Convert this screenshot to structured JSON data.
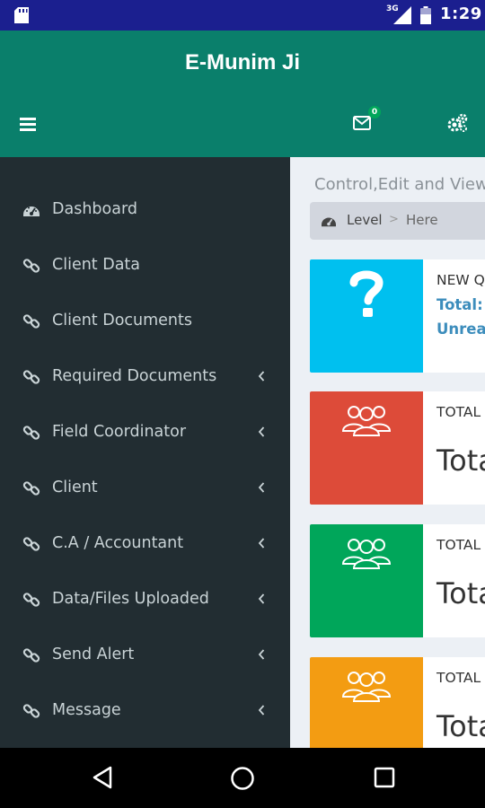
{
  "status_bar": {
    "network": "3G",
    "time": "1:29"
  },
  "app": {
    "title": "E-Munim Ji",
    "mail_badge": "0"
  },
  "sidebar": {
    "items": [
      {
        "label": "Dashboard",
        "icon": "dashboard-icon",
        "has_submenu": false
      },
      {
        "label": "Client Data",
        "icon": "link-icon",
        "has_submenu": false
      },
      {
        "label": "Client Documents",
        "icon": "link-icon",
        "has_submenu": false
      },
      {
        "label": "Required Documents",
        "icon": "link-icon",
        "has_submenu": true
      },
      {
        "label": "Field Coordinator",
        "icon": "link-icon",
        "has_submenu": true
      },
      {
        "label": "Client",
        "icon": "link-icon",
        "has_submenu": true
      },
      {
        "label": "C.A / Accountant",
        "icon": "link-icon",
        "has_submenu": true
      },
      {
        "label": "Data/Files Uploaded",
        "icon": "link-icon",
        "has_submenu": true
      },
      {
        "label": "Send Alert",
        "icon": "link-icon",
        "has_submenu": true
      },
      {
        "label": "Message",
        "icon": "link-icon",
        "has_submenu": true
      }
    ]
  },
  "content": {
    "header": "Control,Edit and View",
    "breadcrumb": {
      "level": "Level",
      "separator": ">",
      "here": "Here"
    },
    "boxes": [
      {
        "color": "#00c0ef",
        "icon": "question-icon",
        "title": "NEW Q",
        "line1": "Total:",
        "line2": "Unread"
      },
      {
        "color": "#dd4b39",
        "icon": "users-icon",
        "title": "TOTAL",
        "value": "Total"
      },
      {
        "color": "#00a65a",
        "icon": "users-icon",
        "title": "TOTAL",
        "value": "Total"
      },
      {
        "color": "#f39c12",
        "icon": "users-icon",
        "title": "TOTAL",
        "value": "Total"
      }
    ]
  }
}
